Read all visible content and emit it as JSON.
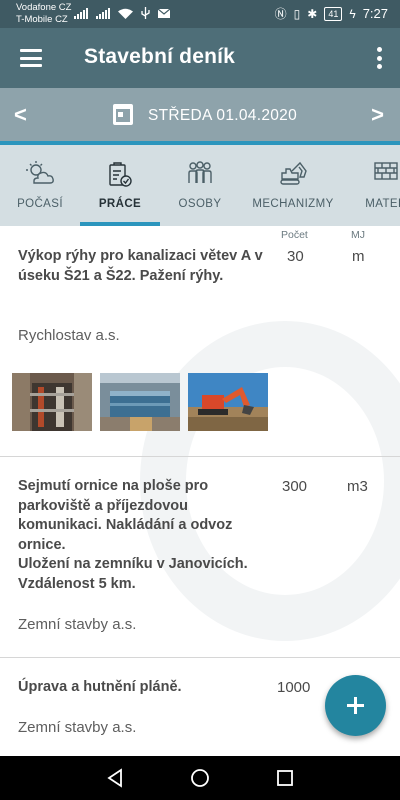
{
  "status_bar": {
    "carrier_1": "Vodafone CZ",
    "carrier_2": "T-Mobile CZ",
    "battery": "41",
    "time": "7:27"
  },
  "app_bar": {
    "title": "Stavební deník"
  },
  "date_bar": {
    "date": "STŘEDA 01.04.2020"
  },
  "tabs": [
    {
      "label": "POČASÍ",
      "icon": "weather-icon",
      "active": false
    },
    {
      "label": "PRÁCE",
      "icon": "clipboard-icon",
      "active": true
    },
    {
      "label": "OSOBY",
      "icon": "people-icon",
      "active": false
    },
    {
      "label": "MECHANIZMY",
      "icon": "excavator-icon",
      "active": false
    },
    {
      "label": "MATER",
      "icon": "bricks-icon",
      "active": false
    }
  ],
  "columns": {
    "count": "Počet",
    "unit": "MJ"
  },
  "items": [
    {
      "title": "Výkop rýhy pro kanalizaci větev A v úseku Š21 a Š22. Pažení rýhy.",
      "count": "30",
      "unit": "m",
      "company": "Rychlostav a.s.",
      "photos": [
        "trench-photo-1",
        "trench-photo-2",
        "excavator-photo"
      ]
    },
    {
      "title": "Sejmutí ornice na ploše pro parkoviště a příjezdovou komunikaci. Nakládání a odvoz ornice.\nUložení na zemníku v Janovicích. Vzdálenost 5 km.",
      "count": "300",
      "unit": "m3",
      "company": "Zemní stavby a.s."
    },
    {
      "title": "Úprava a hutnění pláně.",
      "count": "1000",
      "unit": "",
      "company": "Zemní stavby a.s."
    }
  ],
  "colors": {
    "status_bar": "#3f5a63",
    "app_bar": "#4e6e78",
    "date_bar": "#8ea3ab",
    "accent": "#2b95bd",
    "tabs_bg": "#d4dee2",
    "fab": "#23859f"
  }
}
